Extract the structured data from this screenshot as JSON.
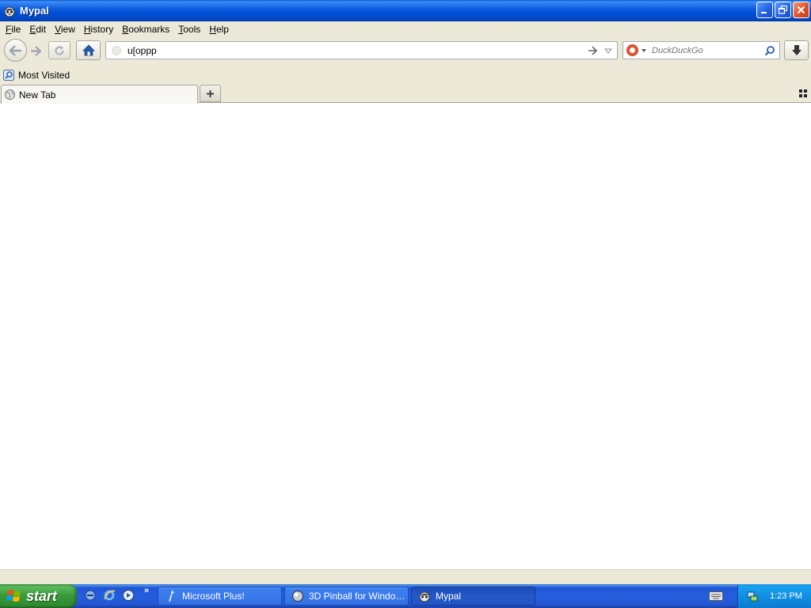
{
  "window": {
    "title": "Mypal"
  },
  "menu": {
    "items": [
      {
        "label": "File",
        "u": "F",
        "rest": "ile"
      },
      {
        "label": "Edit",
        "u": "E",
        "rest": "dit"
      },
      {
        "label": "View",
        "u": "V",
        "rest": "iew"
      },
      {
        "label": "History",
        "u": "H",
        "rest": "istory"
      },
      {
        "label": "Bookmarks",
        "u": "B",
        "rest": "ookmarks"
      },
      {
        "label": "Tools",
        "u": "T",
        "rest": "ools"
      },
      {
        "label": "Help",
        "u": "H",
        "rest": "elp"
      }
    ]
  },
  "navbar": {
    "url_value": "u[oppp",
    "search_placeholder": "DuckDuckGo",
    "search_engine_icon": "duckduckgo-icon"
  },
  "bookmarks": {
    "items": [
      {
        "label": "Most Visited",
        "icon": "most-visited-icon"
      }
    ]
  },
  "tabs": [
    {
      "label": "New Tab",
      "icon": "globe-icon"
    }
  ],
  "taskbar": {
    "start_label": "start",
    "windows": [
      {
        "label": "Microsoft Plus!",
        "icon": "plus-icon"
      },
      {
        "label": "3D Pinball for Window...",
        "icon": "pinball-icon"
      },
      {
        "label": "Mypal",
        "icon": "mypal-icon",
        "active": true
      }
    ],
    "clock": "1:23 PM"
  },
  "colors": {
    "titlebar": "#0050d8",
    "chrome": "#ece9d8",
    "taskbar": "#245edc",
    "start": "#3b9a3b",
    "tray": "#0f8be0"
  }
}
